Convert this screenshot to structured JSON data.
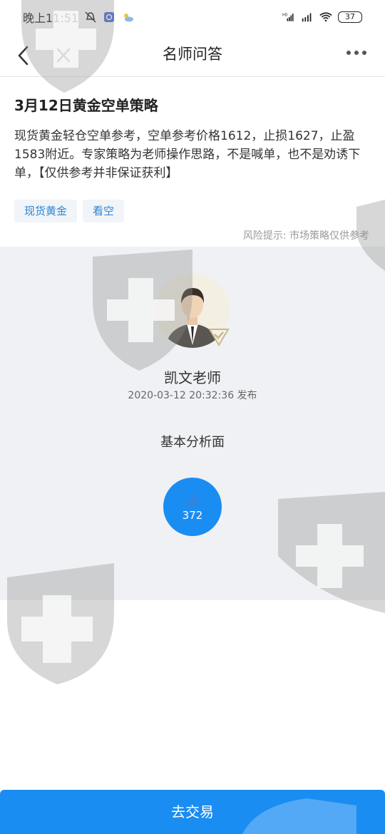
{
  "status_bar": {
    "time": "晚上11:51",
    "battery": "37",
    "icons": [
      "mute-icon",
      "app-icon",
      "weather-icon",
      "hd-signal-icon",
      "signal-icon",
      "wifi-icon"
    ]
  },
  "nav": {
    "title": "名师问答",
    "icons": [
      "back-icon",
      "close-icon",
      "more-icon"
    ]
  },
  "article": {
    "title": "3月12日黄金空单策略",
    "body": "现货黄金轻仓空单参考，空单参考价格1612，止损1627，止盈1583附近。专家策略为老师操作思路，不是喊单，也不是劝诱下单，【仅供参考并非保证获利】",
    "tags": [
      "现货黄金",
      "看空"
    ],
    "risk_note": "风险提示: 市场策略仅供参考"
  },
  "author": {
    "name": "凯文老师",
    "publish_line": "2020-03-12 20:32:36 发布",
    "category": "基本分析面",
    "like_count": "372"
  },
  "actions": {
    "trade_label": "去交易"
  },
  "colors": {
    "accent": "#1a8df2",
    "tag_text": "#2b86d6",
    "section_bg": "#eff1f4"
  }
}
